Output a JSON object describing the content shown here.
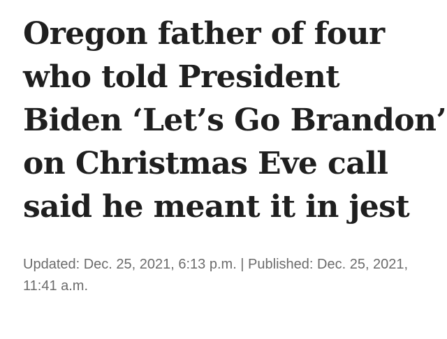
{
  "article": {
    "headline_lines": [
      "Oregon father of four",
      "who told President",
      "Biden ‘Let’s Go Brandon’",
      "on Christmas Eve call",
      "said he meant it in jest"
    ],
    "timestamp": "Updated: Dec. 25, 2021, 6:13 p.m. | Published: Dec. 25, 2021, 11:41 a.m."
  },
  "colors": {
    "headline": "#1f1f1f",
    "timestamp": "#6b6b6b",
    "background": "#ffffff"
  }
}
